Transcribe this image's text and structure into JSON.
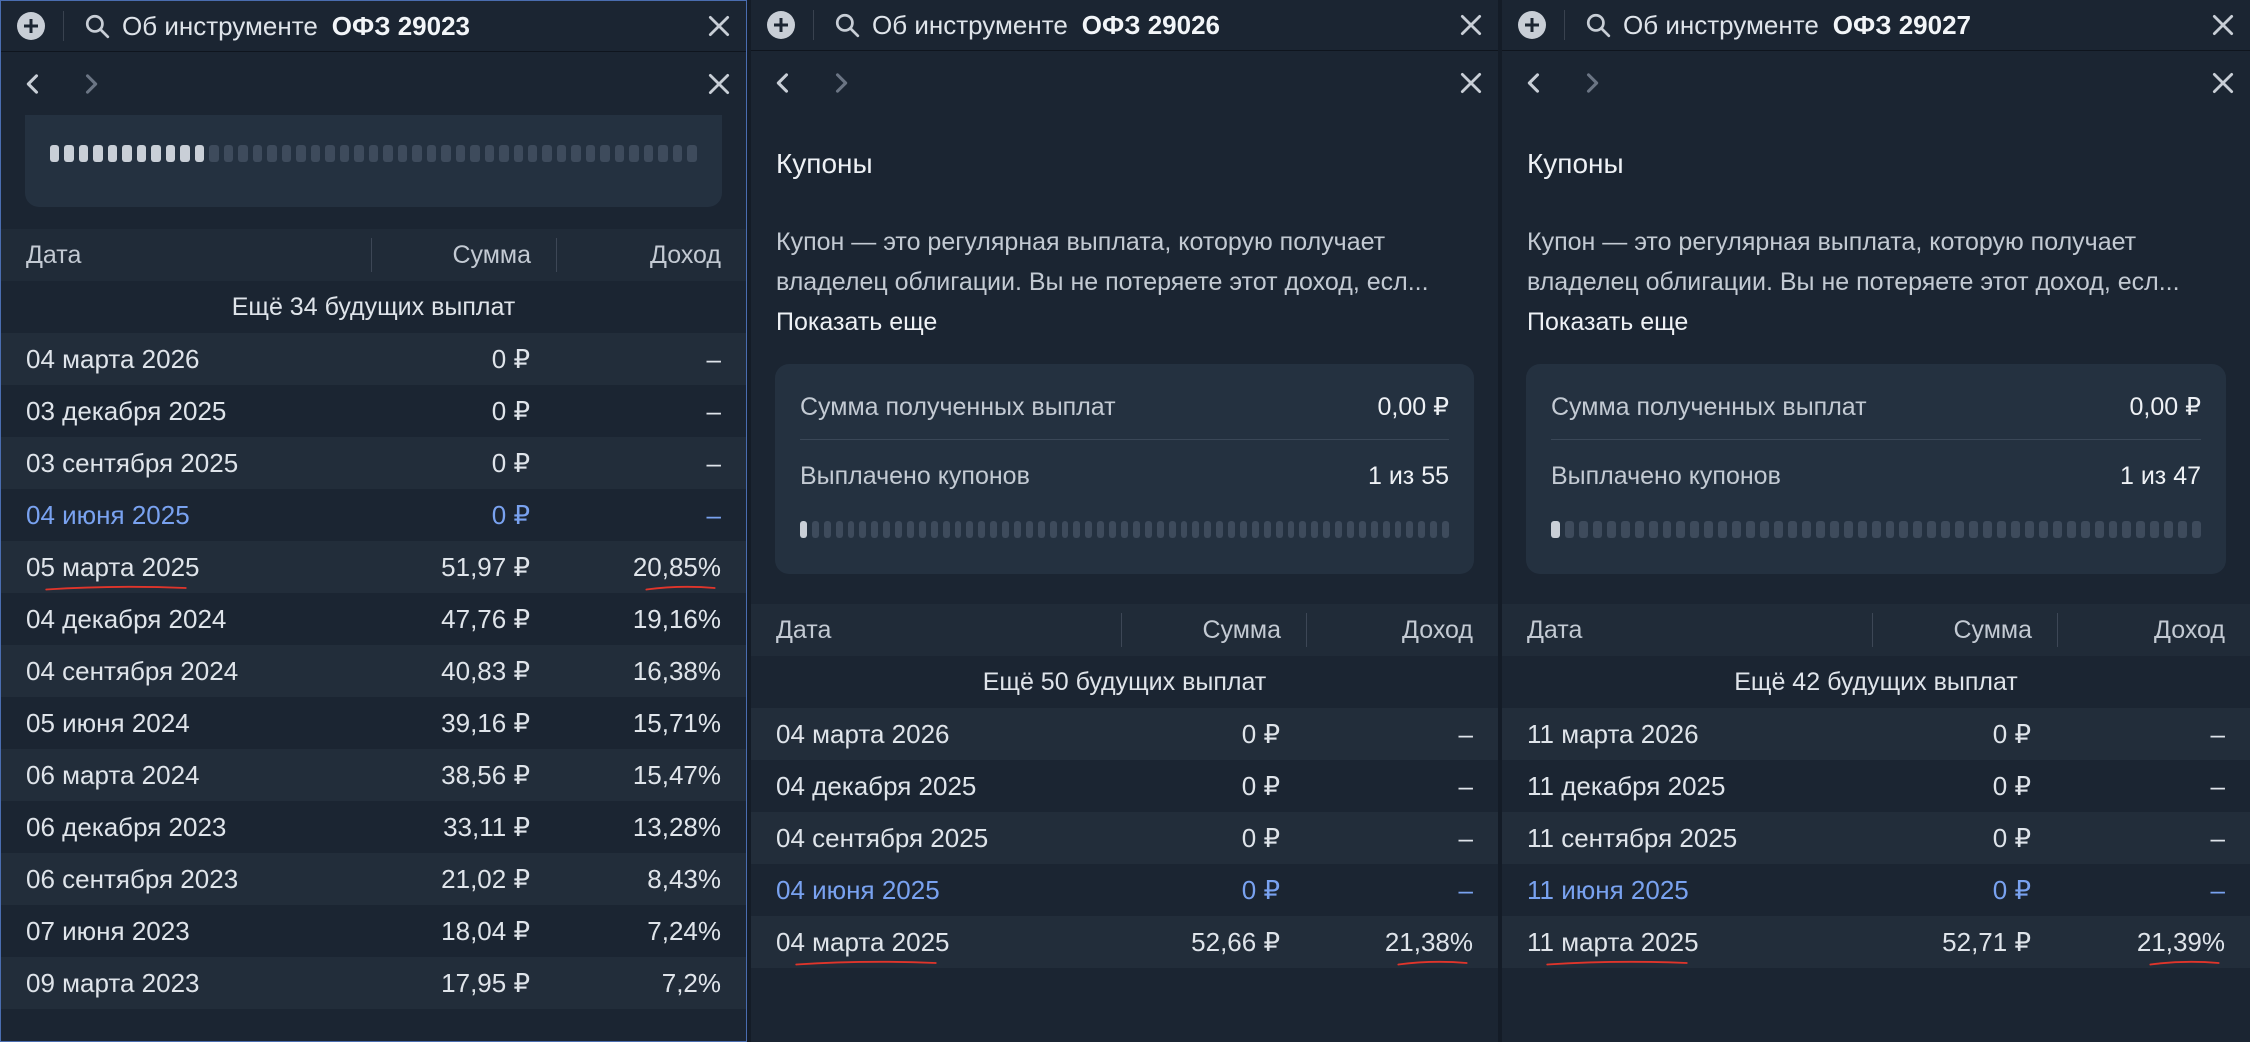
{
  "common": {
    "title_label": "Об инструменте",
    "coupons_title": "Купоны",
    "description_line1": "Купон — это регулярная выплата, которую получает",
    "description_line2": "владелец облигации. Вы не потеряете этот доход, есл...",
    "show_more": "Показать еще",
    "received_label": "Сумма полученных выплат",
    "paid_label": "Выплачено купонов",
    "col_date": "Дата",
    "col_sum": "Сумма",
    "col_income": "Доход",
    "icons": {
      "add": "plus-icon",
      "search": "search-icon",
      "close": "close-icon",
      "back": "chevron-left-icon",
      "forward": "chevron-right-icon"
    },
    "colors": {
      "accent": "#79a2f0",
      "underline": "#e0352b"
    }
  },
  "panels": [
    {
      "ticker": "ОФЗ 29023",
      "progress": {
        "done": 11,
        "total": 45
      },
      "more_text": "Ещё 34 будущих выплат",
      "rows": [
        {
          "date": "04 марта 2026",
          "sum": "0 ₽",
          "income": "–"
        },
        {
          "date": "03 декабря 2025",
          "sum": "0 ₽",
          "income": "–"
        },
        {
          "date": "03 сентября 2025",
          "sum": "0 ₽",
          "income": "–"
        },
        {
          "date": "04 июня 2025",
          "sum": "0 ₽",
          "income": "–",
          "current": true
        },
        {
          "date": "05 марта 2025",
          "sum": "51,97 ₽",
          "income": "20,85%",
          "marked": true
        },
        {
          "date": "04 декабря 2024",
          "sum": "47,76 ₽",
          "income": "19,16%"
        },
        {
          "date": "04 сентября 2024",
          "sum": "40,83 ₽",
          "income": "16,38%"
        },
        {
          "date": "05 июня 2024",
          "sum": "39,16 ₽",
          "income": "15,71%"
        },
        {
          "date": "06 марта 2024",
          "sum": "38,56 ₽",
          "income": "15,47%"
        },
        {
          "date": "06 декабря 2023",
          "sum": "33,11 ₽",
          "income": "13,28%"
        },
        {
          "date": "06 сентября 2023",
          "sum": "21,02 ₽",
          "income": "8,43%"
        },
        {
          "date": "07 июня 2023",
          "sum": "18,04 ₽",
          "income": "7,24%"
        },
        {
          "date": "09 марта 2023",
          "sum": "17,95 ₽",
          "income": "7,2%"
        }
      ]
    },
    {
      "ticker": "ОФЗ 29026",
      "received_value": "0,00 ₽",
      "paid_value": "1 из 55",
      "progress": {
        "done": 1,
        "total": 55
      },
      "more_text": "Ещё 50 будущих выплат",
      "rows": [
        {
          "date": "04 марта 2026",
          "sum": "0 ₽",
          "income": "–"
        },
        {
          "date": "04 декабря 2025",
          "sum": "0 ₽",
          "income": "–"
        },
        {
          "date": "04 сентября 2025",
          "sum": "0 ₽",
          "income": "–"
        },
        {
          "date": "04 июня 2025",
          "sum": "0 ₽",
          "income": "–",
          "current": true
        },
        {
          "date": "04 марта 2025",
          "sum": "52,66 ₽",
          "income": "21,38%",
          "marked": true
        }
      ]
    },
    {
      "ticker": "ОФЗ 29027",
      "received_value": "0,00 ₽",
      "paid_value": "1 из 47",
      "progress": {
        "done": 1,
        "total": 47
      },
      "more_text": "Ещё 42 будущих выплат",
      "rows": [
        {
          "date": "11 марта 2026",
          "sum": "0 ₽",
          "income": "–"
        },
        {
          "date": "11 декабря 2025",
          "sum": "0 ₽",
          "income": "–"
        },
        {
          "date": "11 сентября 2025",
          "sum": "0 ₽",
          "income": "–"
        },
        {
          "date": "11 июня 2025",
          "sum": "0 ₽",
          "income": "–",
          "current": true
        },
        {
          "date": "11 марта 2025",
          "sum": "52,71 ₽",
          "income": "21,39%",
          "marked": true
        }
      ]
    }
  ]
}
